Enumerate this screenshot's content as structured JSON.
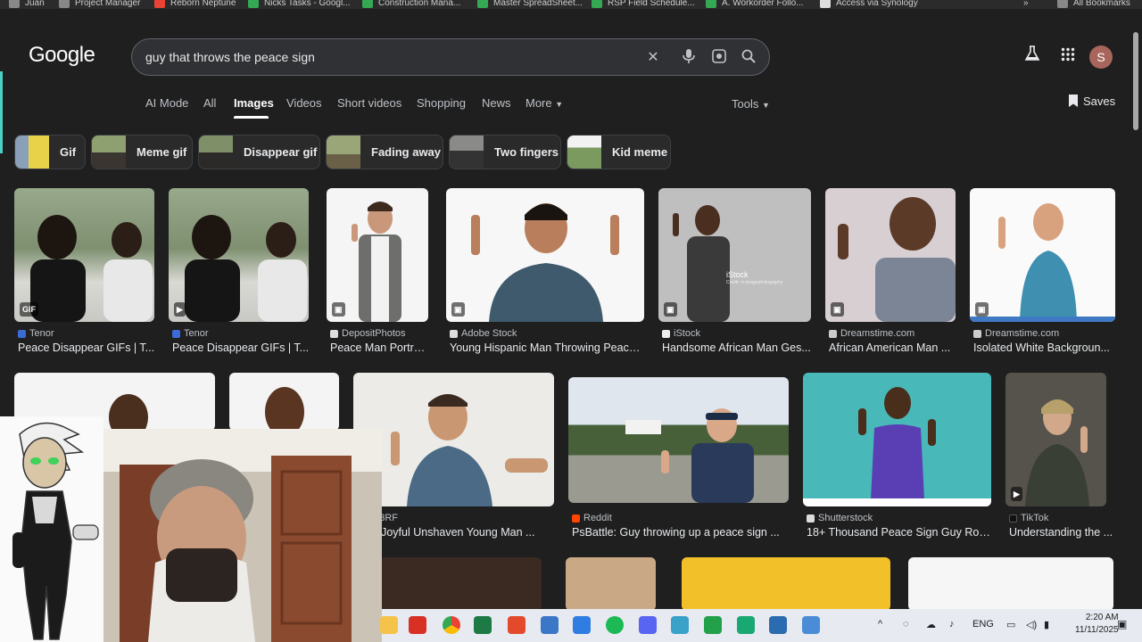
{
  "bookmarks": [
    "Juan",
    "Project Manager",
    "Reborn Neptune",
    "Nicks Tasks - Googl...",
    "Construction Mana...",
    "Master SpreadSheet...",
    "RSP Field Schedule...",
    "A. Workorder Follo...",
    "Access via Synology"
  ],
  "bookmarks_overflow": "»",
  "all_bookmarks": "All Bookmarks",
  "logo": "Google",
  "search": {
    "query": "guy that throws the peace sign"
  },
  "tabs": [
    "AI Mode",
    "All",
    "Images",
    "Videos",
    "Short videos",
    "Shopping",
    "News",
    "More"
  ],
  "tools": "Tools",
  "saves": "Saves",
  "avatar_letter": "S",
  "chips": [
    "Gif",
    "Meme gif",
    "Disappear gif",
    "Fading away",
    "Two fingers",
    "Kid meme"
  ],
  "results_row1": [
    {
      "source": "Tenor",
      "title": "Peace Disappear GIFs | T...",
      "badge": "GIF"
    },
    {
      "source": "Tenor",
      "title": "Peace Disappear GIFs | T...",
      "badge": "▶"
    },
    {
      "source": "DepositPhotos",
      "title": "Peace Man Portrai...",
      "badge": "▣"
    },
    {
      "source": "Adobe Stock",
      "title": "Young Hispanic Man Throwing Peace ...",
      "badge": "▣"
    },
    {
      "source": "iStock",
      "title": "Handsome African Man Ges...",
      "badge": "▣"
    },
    {
      "source": "Dreamstime.com",
      "title": "African American Man ...",
      "badge": "▣"
    },
    {
      "source": "Dreamstime.com",
      "title": "Isolated White Backgroun...",
      "badge": "▣"
    }
  ],
  "results_row2": [
    {
      "source": "123RF",
      "title": "o Of Joyful Unshaven Young Man ..."
    },
    {
      "source": "Reddit",
      "title": "PsBattle: Guy throwing up a peace sign ..."
    },
    {
      "source": "Shutterstock",
      "title": "18+ Thousand Peace Sign Guy Roy..."
    },
    {
      "source": "TikTok",
      "title": "Understanding the ..."
    }
  ],
  "istock_watermark": "iStock",
  "istock_credit": "Credit: m-imagephotography",
  "tray": {
    "lang": "ENG",
    "time": "2:20 AM",
    "date": "11/11/2025"
  }
}
